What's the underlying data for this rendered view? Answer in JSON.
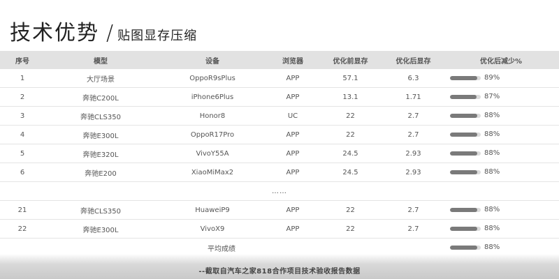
{
  "title": {
    "main": "技术优势",
    "slash": "/",
    "sub": "贴图显存压缩"
  },
  "table": {
    "headers": [
      "序号",
      "模型",
      "设备",
      "浏览器",
      "优化前显存",
      "优化后显存",
      "优化后减少%"
    ],
    "rows": [
      [
        "1",
        "大厅场景",
        "OppoR9sPlus",
        "APP",
        "57.1",
        "6.3",
        "89%"
      ],
      [
        "2",
        "奔驰C200L",
        "iPhone6Plus",
        "APP",
        "13.1",
        "1.71",
        "87%"
      ],
      [
        "3",
        "奔驰CLS350",
        "Honor8",
        "UC",
        "22",
        "2.7",
        "88%"
      ],
      [
        "4",
        "奔驰E300L",
        "OppoR17Pro",
        "APP",
        "22",
        "2.7",
        "88%"
      ],
      [
        "5",
        "奔驰E320L",
        "VivoY55A",
        "APP",
        "24.5",
        "2.93",
        "88%"
      ],
      [
        "6",
        "奔驰E200",
        "XiaoMiMax2",
        "APP",
        "24.5",
        "2.93",
        "88%"
      ]
    ],
    "ellipsis": "……",
    "rows_after": [
      [
        "21",
        "奔驰CLS350",
        "HuaweiP9",
        "APP",
        "22",
        "2.7",
        "88%"
      ],
      [
        "22",
        "奔驰E300L",
        "VivoX9",
        "APP",
        "22",
        "2.7",
        "88%"
      ]
    ],
    "average": {
      "label": "平均成绩",
      "value": "88%"
    }
  },
  "footer": "--截取自汽车之家818合作项目技术验收报告数据"
}
